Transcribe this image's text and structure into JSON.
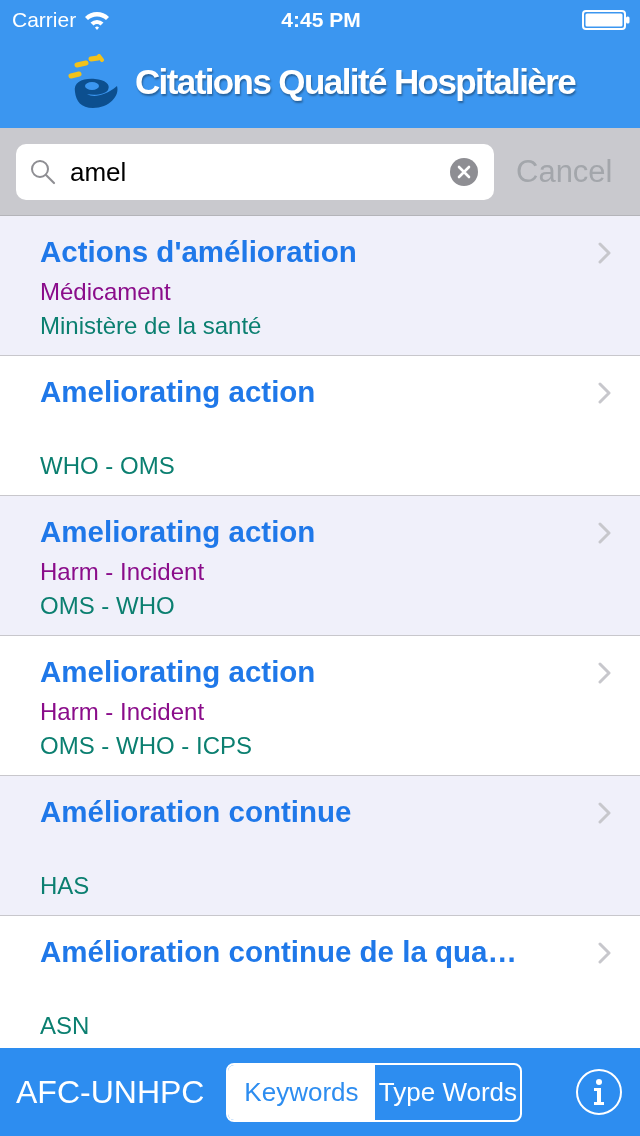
{
  "status_bar": {
    "carrier": "Carrier",
    "time": "4:45 PM"
  },
  "header": {
    "title": "Citations Qualité Hospitalière"
  },
  "search": {
    "value": "amel",
    "cancel": "Cancel"
  },
  "results": [
    {
      "title": "Actions d'amélioration",
      "category": "Médicament",
      "source": "Ministère de la santé"
    },
    {
      "title": "Ameliorating action",
      "source": "WHO - OMS"
    },
    {
      "title": "Ameliorating action",
      "category": "Harm - Incident",
      "source": "OMS - WHO"
    },
    {
      "title": "Ameliorating action",
      "category": "Harm - Incident",
      "source": "OMS - WHO - ICPS"
    },
    {
      "title": "Amélioration continue",
      "source": "HAS"
    },
    {
      "title": "Amélioration continue de la qua…",
      "source": "ASN"
    }
  ],
  "bottom_bar": {
    "label": "AFC-UNHPC",
    "segments": [
      {
        "label": "Keywords",
        "selected": true
      },
      {
        "label": "Type Words",
        "selected": false
      }
    ]
  }
}
